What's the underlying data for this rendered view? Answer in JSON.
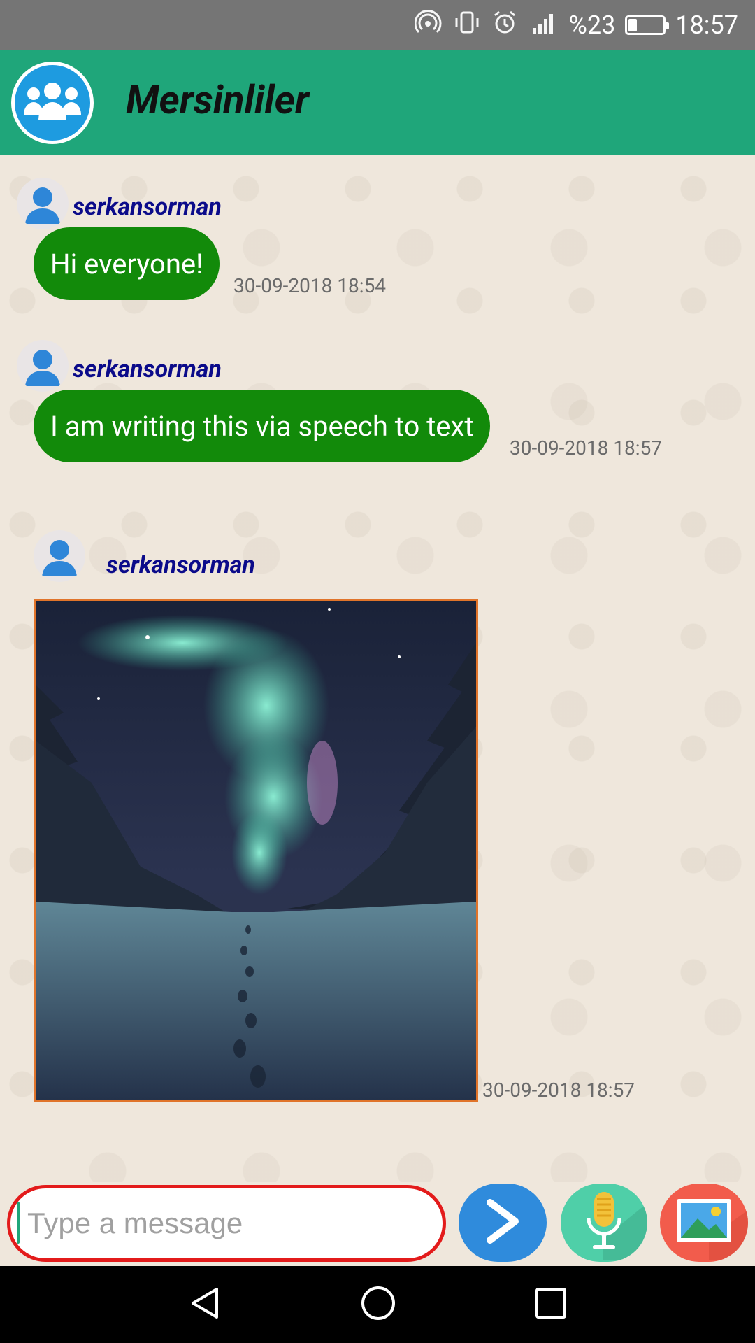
{
  "status_bar": {
    "battery_text": "%23",
    "battery_level": 0.23,
    "time": "18:57",
    "icons": [
      "hotspot-icon",
      "vibrate-icon",
      "alarm-icon",
      "signal-icon",
      "battery-icon"
    ]
  },
  "app_bar": {
    "title": "Mersinliler",
    "avatar_icon": "group-icon"
  },
  "messages": [
    {
      "sender": "serkansorman",
      "type": "text",
      "text": "Hi everyone!",
      "timestamp": "30-09-2018 18:54"
    },
    {
      "sender": "serkansorman",
      "type": "text",
      "text": "I am writing this via speech to text",
      "timestamp": "30-09-2018 18:57"
    },
    {
      "sender": "serkansorman",
      "type": "image",
      "image_icon": "aurora-forest-photo",
      "timestamp": "30-09-2018 18:57"
    }
  ],
  "input": {
    "placeholder": "Type a message",
    "value": ""
  },
  "actions": {
    "send_icon": "send-icon",
    "mic_icon": "microphone-icon",
    "image_icon": "gallery-icon"
  },
  "colors": {
    "app_bar": "#1fa67a",
    "bubble": "#128a0a",
    "sender_name": "#0b0b8a",
    "input_border": "#e31b1b",
    "send_button": "#2f8bdc",
    "mic_button": "#4fcfa8",
    "image_button": "#f25c4c"
  }
}
